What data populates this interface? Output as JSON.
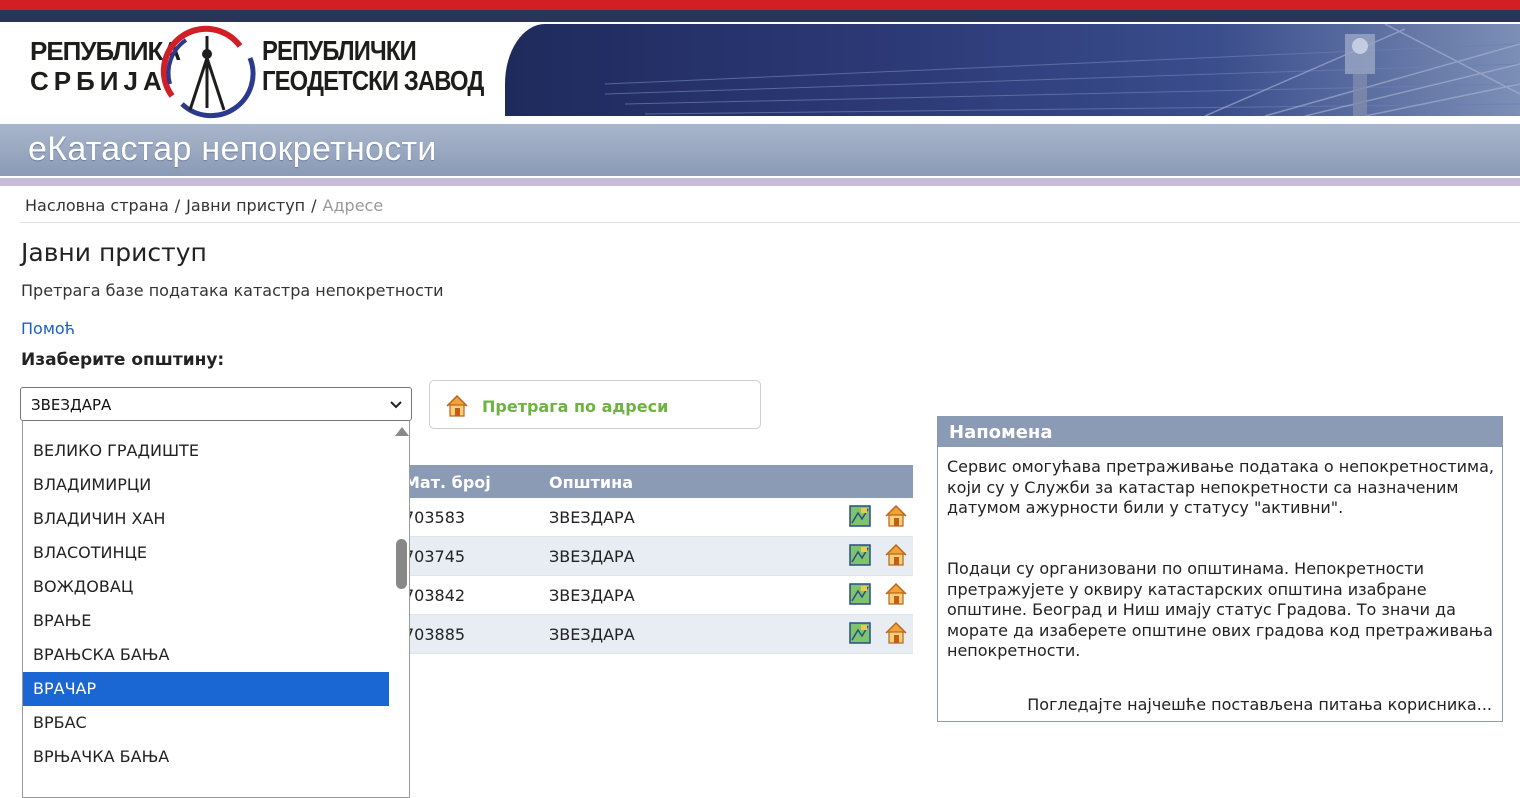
{
  "header": {
    "logo_left_line1": "РЕПУБЛИКА",
    "logo_left_line2": "СРБИЈА",
    "logo_right_line1": "РЕПУБЛИЧКИ",
    "logo_right_line2": "ГЕОДЕТСКИ ЗАВОД",
    "app_title": "еКатастар непокретности"
  },
  "colors": {
    "accent_red": "#d21f26",
    "navy": "#2b3557",
    "title_bar": "#8b9ab5",
    "selected": "#1a66d2",
    "search_green": "#6db33f"
  },
  "breadcrumb": {
    "home": "Насловна страна",
    "public": "Јавни приступ",
    "current": "Адресе",
    "separator": "/"
  },
  "page": {
    "heading": "Јавни приступ",
    "subheading": "Претрага базе података катастра непокретности",
    "help_link": "Помоћ",
    "choose_label": "Изаберите општину:"
  },
  "municipality_select": {
    "value": "ЗВЕЗДАРА",
    "options": [
      "ВЕЛИКО ГРАДИШТЕ",
      "ВЛАДИМИРЦИ",
      "ВЛАДИЧИН ХАН",
      "ВЛАСОТИНЦЕ",
      "ВОЖДОВАЦ",
      "ВРАЊЕ",
      "ВРАЊСКА БАЊА",
      "ВРАЧАР",
      "ВРБАС",
      "ВРЊАЧКА БАЊА"
    ],
    "highlighted": "ВРАЧАР"
  },
  "search_button": {
    "label": "Претрага по адреси",
    "icon": "house-icon"
  },
  "table": {
    "headers": [
      "Мат. број",
      "Општина"
    ],
    "rows": [
      {
        "mat": "703583",
        "opstina": "ЗВЕЗДАРА"
      },
      {
        "mat": "703745",
        "opstina": "ЗВЕЗДАРА"
      },
      {
        "mat": "703842",
        "opstina": "ЗВЕЗДАРА"
      },
      {
        "mat": "703885",
        "opstina": "ЗВЕЗДАРА"
      }
    ]
  },
  "note": {
    "title": "Напомена",
    "p1": "Сервис омогућава претраживање података о непокретностима, који су у Служби за катастар непокретности са назначеним датумом ажурности били у статусу \"активни\".",
    "p2": "Подаци су организовани по општинама. Непокретности претражујете у оквиру катастарских општина изабране општине. Београд и Ниш имају статус Градова. То значи да морате да изаберете општине ових градова код претраживања непокретности.",
    "faq_link": "Погледајте најчешће постављена питања корисника..."
  }
}
